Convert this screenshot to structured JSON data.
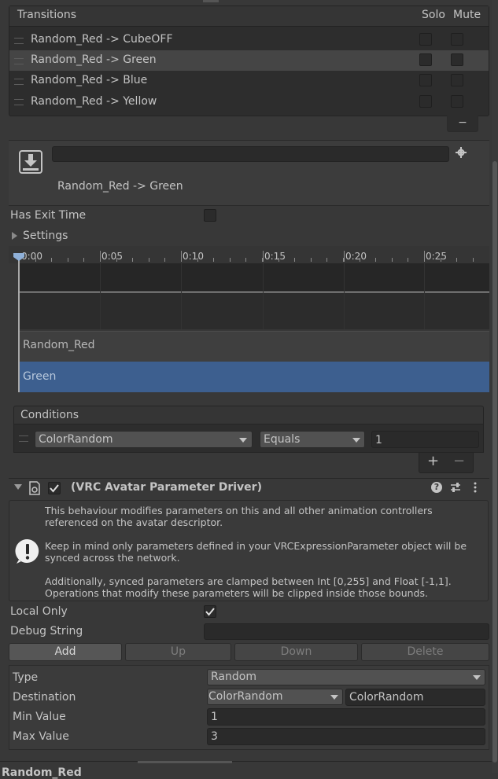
{
  "transitions": {
    "header": "Transitions",
    "solo_label": "Solo",
    "mute_label": "Mute",
    "items": [
      {
        "label": "Random_Red -> CubeOFF"
      },
      {
        "label": "Random_Red -> Green"
      },
      {
        "label": "Random_Red -> Blue"
      },
      {
        "label": "Random_Red -> Yellow"
      }
    ],
    "remove_label": "−"
  },
  "inspector": {
    "name_value": "",
    "transition_title": "Random_Red -> Green",
    "has_exit_time_label": "Has Exit Time",
    "settings_label": "Settings"
  },
  "timeline": {
    "ticks": [
      "0:00",
      "0:05",
      "0:10",
      "0:15",
      "0:20",
      "0:25"
    ],
    "source_state": "Random_Red",
    "dest_state": "Green"
  },
  "conditions": {
    "header": "Conditions",
    "parameter": "ColorRandom",
    "mode": "Equals",
    "value": "1",
    "add_label": "+",
    "remove_label": "−"
  },
  "driver": {
    "title": "(VRC Avatar Parameter Driver)",
    "info_line1": "This behaviour modifies parameters on this and all other animation controllers",
    "info_line2": "referenced on the avatar descriptor.",
    "warn_line1": "Keep in mind only parameters defined in your VRCExpressionParameter object will be",
    "warn_line2": "synced across the network.",
    "clamp_line1": "Additionally, synced parameters are clamped between Int [0,255] and Float [-1,1].",
    "clamp_line2": "Operations that modify these parameters will be clipped inside those bounds.",
    "local_only_label": "Local Only",
    "debug_string_label": "Debug String",
    "debug_string_value": "",
    "buttons": {
      "add": "Add",
      "up": "Up",
      "down": "Down",
      "delete": "Delete"
    },
    "type_label": "Type",
    "type_value": "Random",
    "destination_label": "Destination",
    "destination_dropdown": "ColorRandom",
    "destination_value": "ColorRandom",
    "min_label": "Min Value",
    "min_value": "1",
    "max_label": "Max Value",
    "max_value": "3"
  },
  "footer_state": "Random_Red",
  "colors": {
    "background": "#383838",
    "panel": "#2a2a2a",
    "selected_row": "#444444",
    "dest_state": "#3d5f8f"
  }
}
